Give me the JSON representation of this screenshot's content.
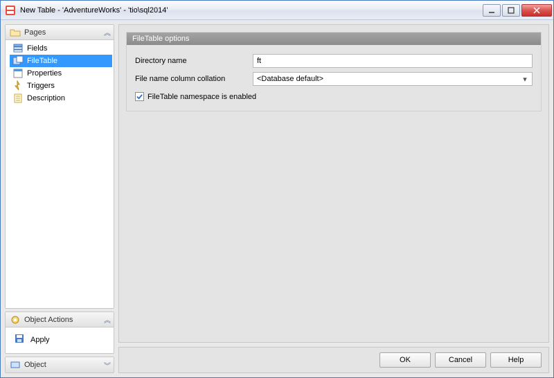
{
  "window": {
    "title": "New Table - 'AdventureWorks' - 'tio\\sql2014'"
  },
  "sidebar": {
    "pages_header": "Pages",
    "items": [
      {
        "label": "Fields",
        "icon": "fields"
      },
      {
        "label": "FileTable",
        "icon": "filetable"
      },
      {
        "label": "Properties",
        "icon": "properties"
      },
      {
        "label": "Triggers",
        "icon": "triggers"
      },
      {
        "label": "Description",
        "icon": "description"
      }
    ],
    "selected_index": 1,
    "actions_header": "Object Actions",
    "actions": {
      "apply": "Apply"
    },
    "object_header": "Object"
  },
  "main": {
    "section_title": "FileTable options",
    "directory_name_label": "Directory name",
    "directory_name_value": "ft",
    "collation_label": "File name column collation",
    "collation_value": "<Database default>",
    "namespace_checkbox_label": "FileTable namespace is enabled",
    "namespace_checked": true
  },
  "buttons": {
    "ok": "OK",
    "cancel": "Cancel",
    "help": "Help"
  }
}
